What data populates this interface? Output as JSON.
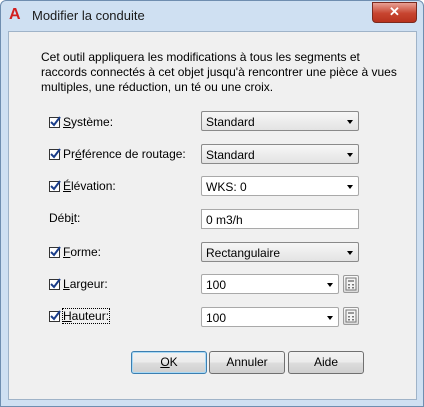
{
  "window": {
    "title": "Modifier la conduite",
    "app_icon": "autocad-icon",
    "close_label": "✕"
  },
  "description": "Cet outil appliquera les modifications à tous les segments et raccords connectés à cet objet jusqu'à rencontrer une pièce à vues multiples, une réduction, un té ou une croix.",
  "fields": {
    "systeme": {
      "checked": true,
      "label_first": "S",
      "label_rest": "ystème:",
      "value": "Standard"
    },
    "preference": {
      "checked": true,
      "label_pre": "Pr",
      "label_ul": "é",
      "label_post": "férence de routage:",
      "value": "Standard"
    },
    "elevation": {
      "checked": true,
      "label_first": "É",
      "label_rest": "lévation:",
      "value": "WKS: 0"
    },
    "debit": {
      "label_pre": "Déb",
      "label_ul": "i",
      "label_post": "t:",
      "value": "0 m3/h"
    },
    "forme": {
      "checked": true,
      "label_first": "F",
      "label_rest": "orme:",
      "value": "Rectangulaire"
    },
    "largeur": {
      "checked": true,
      "label_first": "L",
      "label_rest": "argeur:",
      "value": "100"
    },
    "hauteur": {
      "checked": true,
      "label_first": "H",
      "label_rest": "auteur:",
      "value": "100"
    }
  },
  "buttons": {
    "ok_ul": "O",
    "ok_rest": "K",
    "cancel": "Annuler",
    "help": "Aide"
  }
}
